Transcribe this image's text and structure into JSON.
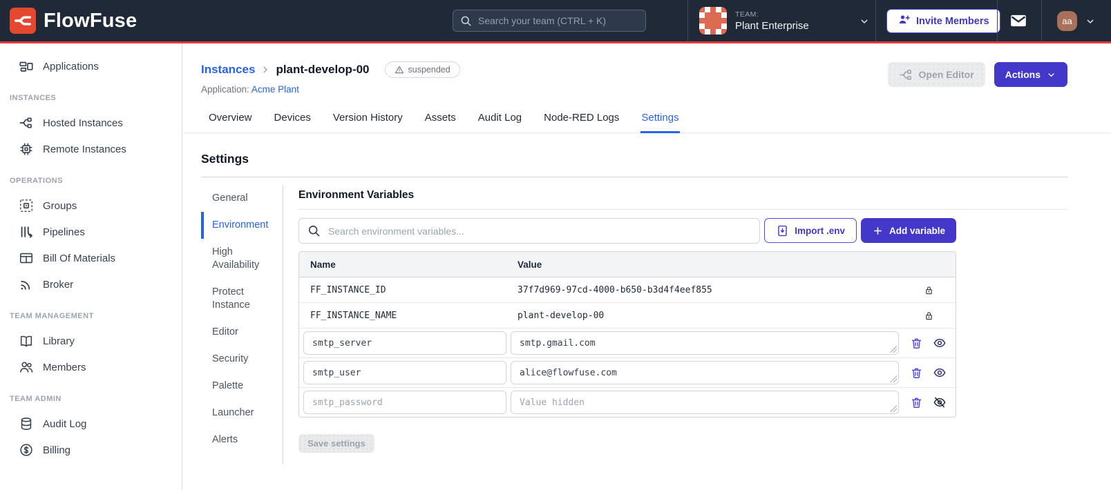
{
  "colors": {
    "navbar_bg": "#1f2937",
    "brand_red": "#e23b3c",
    "logo_red": "#e5472f",
    "accent_indigo": "#4338ca",
    "link_blue": "#2563eb",
    "team_avatar_coral": "#dd6b52",
    "user_avatar_brown": "#a9705a"
  },
  "navbar": {
    "brand": "FlowFuse",
    "search": {
      "placeholder": "Search your team (CTRL + K)",
      "icon": "search-icon"
    },
    "team": {
      "label": "TEAM:",
      "name": "Plant Enterprise",
      "icon": "team-avatar"
    },
    "invite_button": {
      "label": "Invite Members",
      "icon": "user-plus-icon"
    },
    "mail_icon": "mail-icon",
    "user": {
      "initials": "aa"
    }
  },
  "sidebar": {
    "applications": {
      "label": "Applications",
      "icon": "applications-icon"
    },
    "sections": [
      {
        "label": "INSTANCES",
        "items": [
          {
            "label": "Hosted Instances",
            "icon": "hosted-instances-icon"
          },
          {
            "label": "Remote Instances",
            "icon": "remote-instances-icon"
          }
        ]
      },
      {
        "label": "OPERATIONS",
        "items": [
          {
            "label": "Groups",
            "icon": "groups-icon"
          },
          {
            "label": "Pipelines",
            "icon": "pipelines-icon"
          },
          {
            "label": "Bill Of Materials",
            "icon": "bill-of-materials-icon"
          },
          {
            "label": "Broker",
            "icon": "broker-icon"
          }
        ]
      },
      {
        "label": "TEAM MANAGEMENT",
        "items": [
          {
            "label": "Library",
            "icon": "library-icon"
          },
          {
            "label": "Members",
            "icon": "members-icon"
          }
        ]
      },
      {
        "label": "TEAM ADMIN",
        "items": [
          {
            "label": "Audit Log",
            "icon": "audit-log-icon"
          },
          {
            "label": "Billing",
            "icon": "billing-icon"
          }
        ]
      }
    ]
  },
  "header": {
    "breadcrumb": {
      "parent": "Instances",
      "current": "plant-develop-00"
    },
    "status_badge": {
      "label": "suspended",
      "icon": "warning-icon"
    },
    "application_label": "Application:",
    "application_name": "Acme Plant",
    "open_editor_button": {
      "label": "Open Editor",
      "icon": "editor-pipe-icon",
      "disabled": true
    },
    "actions_button": {
      "label": "Actions",
      "icon": "chevron-down-icon"
    }
  },
  "tabs": {
    "items": [
      "Overview",
      "Devices",
      "Version History",
      "Assets",
      "Audit Log",
      "Node-RED Logs",
      "Settings"
    ],
    "active": "Settings"
  },
  "settings": {
    "title": "Settings",
    "nav": {
      "items": [
        "General",
        "Environment",
        "High Availability",
        "Protect Instance",
        "Editor",
        "Security",
        "Palette",
        "Launcher",
        "Alerts"
      ],
      "active": "Environment"
    }
  },
  "environment": {
    "title": "Environment Variables",
    "search_placeholder": "Search environment variables...",
    "import_button": {
      "label": "Import .env",
      "icon": "import-env-icon"
    },
    "add_button": {
      "label": "Add variable",
      "icon": "plus-icon"
    },
    "table": {
      "headers": {
        "name": "Name",
        "value": "Value"
      },
      "locked_rows": [
        {
          "name": "FF_INSTANCE_ID",
          "value": "37f7d969-97cd-4000-b650-b3d4f4eef855",
          "locked": true
        },
        {
          "name": "FF_INSTANCE_NAME",
          "value": "plant-develop-00",
          "locked": true
        }
      ],
      "editable_rows": [
        {
          "name": "smtp_server",
          "value": "smtp.gmail.com",
          "value_hidden": false
        },
        {
          "name": "smtp_user",
          "value": "alice@flowfuse.com",
          "value_hidden": false
        },
        {
          "name": "smtp_password",
          "value": "",
          "value_placeholder": "Value hidden",
          "value_hidden": true
        }
      ]
    },
    "save_button": {
      "label": "Save settings",
      "disabled": true
    }
  }
}
